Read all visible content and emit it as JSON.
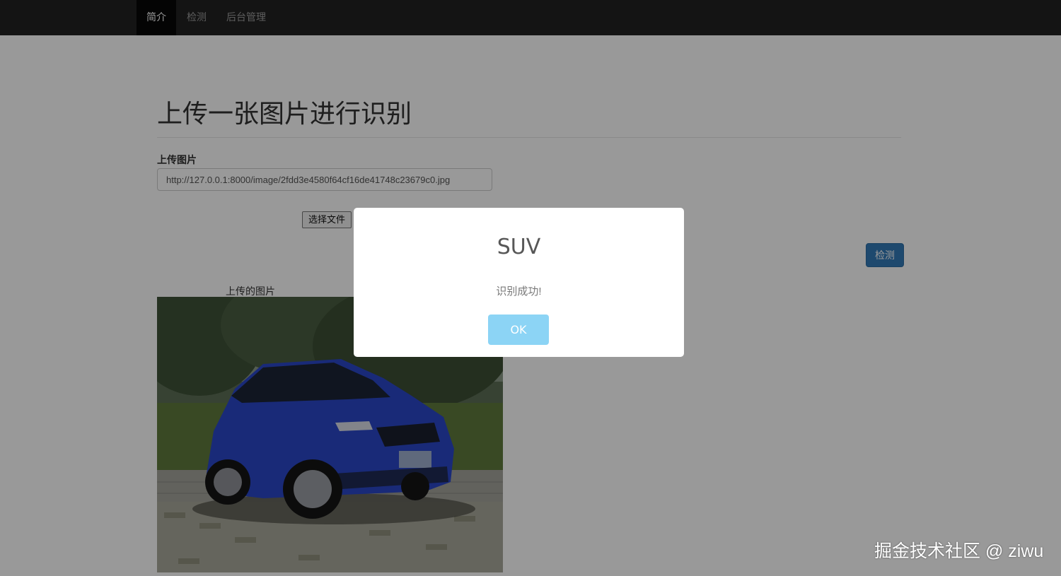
{
  "navbar": {
    "items": [
      {
        "label": "简介",
        "active": true
      },
      {
        "label": "检测",
        "active": false
      },
      {
        "label": "后台管理",
        "active": false
      }
    ]
  },
  "main": {
    "title": "上传一张图片进行识别",
    "upload_label": "上传图片",
    "url_value": "http://127.0.0.1:8000/image/2fdd3e4580f64cf16de41748c23679c0.jpg",
    "file_button": "选择文件",
    "detect_button": "检测",
    "image_caption": "上传的图片"
  },
  "dialog": {
    "title": "SUV",
    "message": "识别成功!",
    "ok": "OK"
  },
  "watermark": "掘金技术社区 @ ziwu",
  "colors": {
    "navbar_bg": "#222222",
    "primary": "#337ab7",
    "ok_button": "#8cd4f5",
    "car": "#2a47c8"
  }
}
